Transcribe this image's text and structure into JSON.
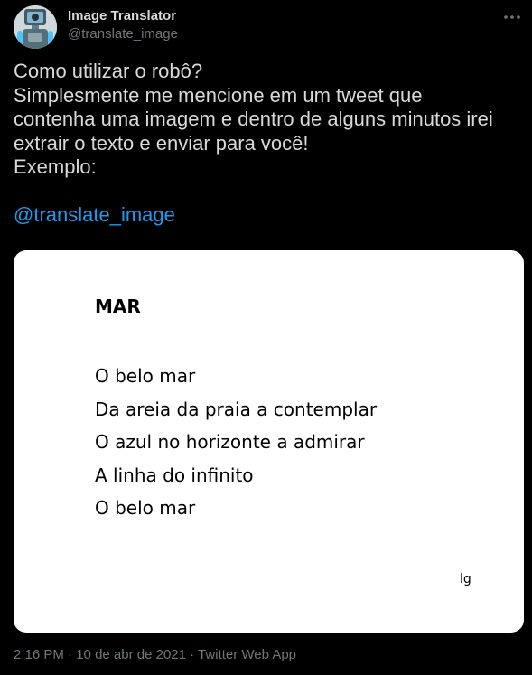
{
  "author": {
    "display_name": "Image Translator",
    "handle": "@translate_image",
    "avatar_icon": "robot-avatar-icon"
  },
  "more_icon": "more-options-icon",
  "tweet": {
    "lines": [
      "Como utilizar o robô?",
      "Simplesmente me mencione em um tweet que",
      "contenha uma imagem e dentro de alguns minutos irei",
      "extrair o texto e enviar para você!",
      "Exemplo:"
    ],
    "mention": "@translate_image"
  },
  "media": {
    "title": "MAR",
    "lines": [
      "O belo mar",
      "Da areia da praia a contemplar",
      "O azul no horizonte a admirar",
      "A linha do infinito",
      "O belo mar"
    ],
    "signature": "lg"
  },
  "meta": {
    "time": "2:16 PM",
    "separator1": " · ",
    "date": "10 de abr de 2021",
    "separator2": " · ",
    "source": "Twitter Web App"
  },
  "colors": {
    "background": "#000000",
    "text": "#d9d9d9",
    "secondary": "#6e767d",
    "link": "#1d9bf0"
  }
}
